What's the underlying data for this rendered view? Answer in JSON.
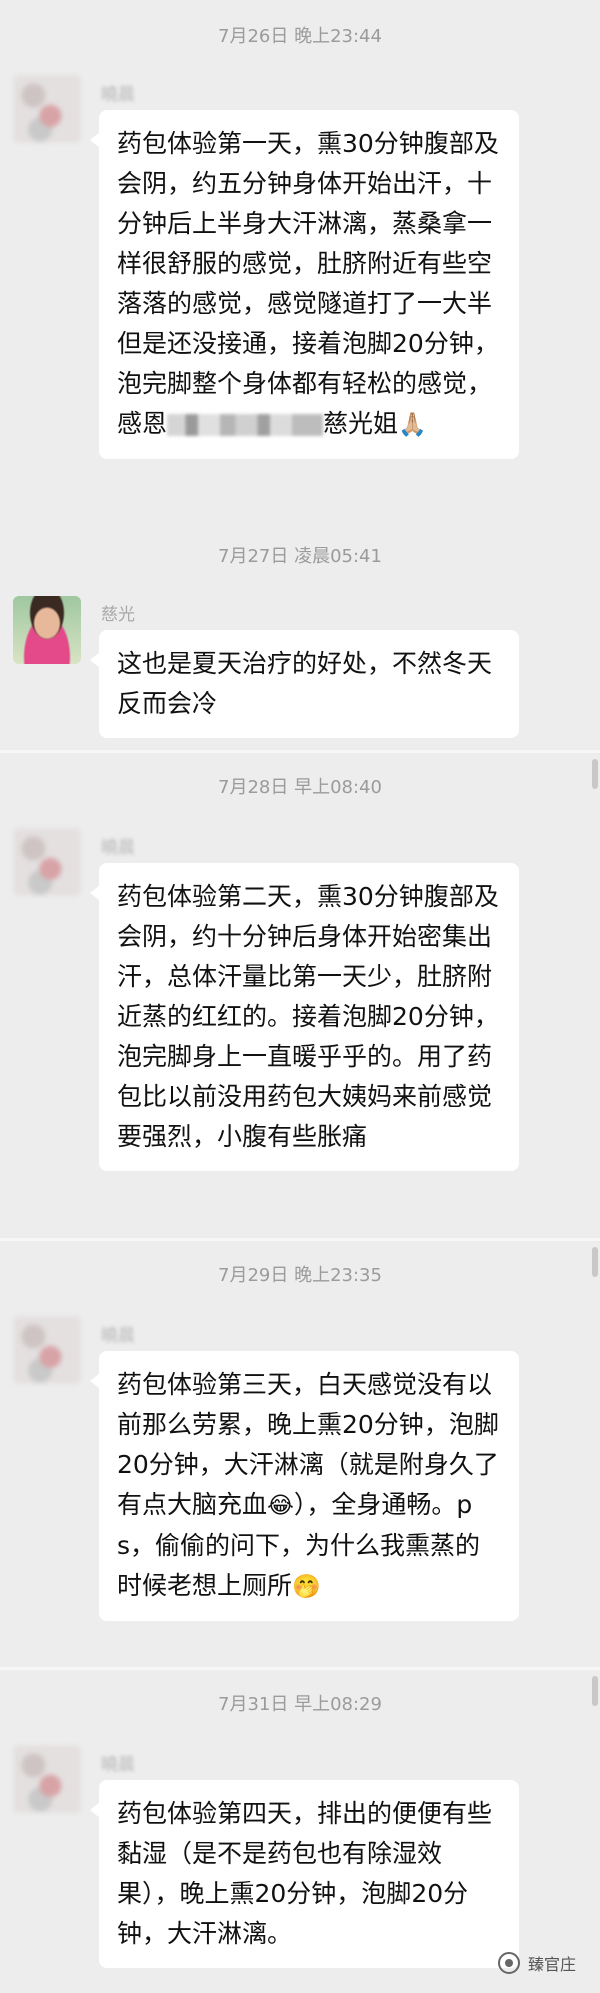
{
  "messages": [
    {
      "time": "7月26日 晚上23:44",
      "sender": "曉晨",
      "text_before": "药包体验第一天，熏30分钟腹部及会阴，约五分钟身体开始出汗，十分钟后上半身大汗淋漓，蒸桑拿一样很舒服的感觉，肚脐附近有些空落落的感觉，感觉隧道打了一大半但是还没接通，接着泡脚20分钟，泡完脚整个身体都有轻松的感觉，感恩",
      "text_after": "慈光姐",
      "emoji": "🙏🏼"
    },
    {
      "time": "7月27日 凌晨05:41",
      "sender": "慈光",
      "text": "这也是夏天治疗的好处，不然冬天反而会冷"
    },
    {
      "time": "7月28日 早上08:40",
      "sender": "曉晨",
      "text": "药包体验第二天，熏30分钟腹部及会阴，约十分钟后身体开始密集出汗，总体汗量比第一天少，肚脐附近蒸的红红的。接着泡脚20分钟，泡完脚身上一直暖乎乎的。用了药包比以前没用药包大姨妈来前感觉要强烈，小腹有些胀痛"
    },
    {
      "time": "7月29日 晚上23:35",
      "sender": "曉晨",
      "text_before": "药包体验第三天，白天感觉没有以前那么劳累，晚上熏20分钟，泡脚20分钟，大汗淋漓（就是附身久了有点大脑充血",
      "emoji1": "😂",
      "text_middle": "），全身通畅。ps，偷偷的问下，为什么我熏蒸的时候老想上厕所",
      "emoji2": "🤭"
    },
    {
      "time": "7月31日 早上08:29",
      "sender": "曉晨",
      "text": "药包体验第四天，排出的便便有些黏湿（是不是药包也有除湿效果），晚上熏20分钟，泡脚20分钟，大汗淋漓。"
    }
  ],
  "watermark": "臻官庄"
}
